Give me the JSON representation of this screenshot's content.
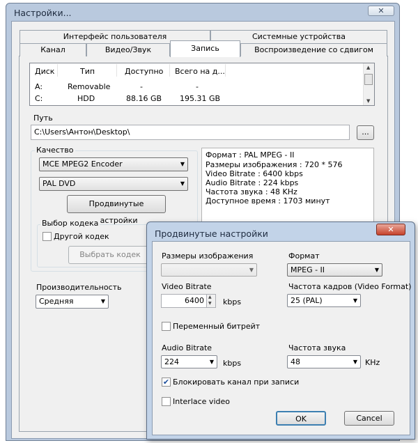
{
  "window": {
    "title": "Настройки...",
    "close": "✕"
  },
  "tabs": {
    "row1": [
      "Интерфейс пользователя",
      "Системные устройства"
    ],
    "row2": [
      "Канал",
      "Видео/Звук",
      "Запись",
      "Воспроизведение со сдвигом"
    ],
    "active": "Запись"
  },
  "disk_table": {
    "columns": [
      "Диск",
      "Тип",
      "Доступно",
      "Всего на д..."
    ],
    "rows": [
      [
        "A:",
        "Removable",
        "-",
        "-"
      ],
      [
        "C:",
        "HDD",
        "88.16 GB",
        "195.31 GB"
      ]
    ]
  },
  "path": {
    "label": "Путь",
    "value": "C:\\Users\\Антон\\Desktop\\",
    "browse": "..."
  },
  "quality": {
    "label": "Качество",
    "encoder": "MCE MPEG2 Encoder",
    "preset": "PAL DVD",
    "advanced_button": "Продвинутые настройки"
  },
  "codec": {
    "label": "Выбор кодека",
    "other_codec": "Другой кодек",
    "choose_button": "Выбрать кодек"
  },
  "performance": {
    "label": "Производительность",
    "value": "Средняя"
  },
  "info": [
    "Формат : PAL MPEG - II",
    "Размеры изображения : 720 * 576",
    "Video Bitrate : 6400 kbps",
    "Audio Bitrate : 224 kbps",
    "Частота звука : 48 KHz",
    "Доступное время : 1703 минут"
  ],
  "dialog": {
    "title": "Продвинутые настройки",
    "close": "✕",
    "image_size_label": "Размеры изображения",
    "format_label": "Формат",
    "format_value": "MPEG - II",
    "video_bitrate_label": "Video Bitrate",
    "video_bitrate_value": "6400",
    "kbps": "kbps",
    "frame_rate_label": "Частота кадров (Video Format)",
    "frame_rate_value": "25 (PAL)",
    "vbr_label": "Переменный битрейт",
    "audio_bitrate_label": "Audio Bitrate",
    "audio_bitrate_value": "224",
    "sample_rate_label": "Частота звука",
    "sample_rate_value": "48",
    "khz": "KHz",
    "lock_channel_label": "Блокировать канал при записи",
    "interlace_label": "Interlace video",
    "ok": "OK",
    "cancel": "Cancel"
  }
}
